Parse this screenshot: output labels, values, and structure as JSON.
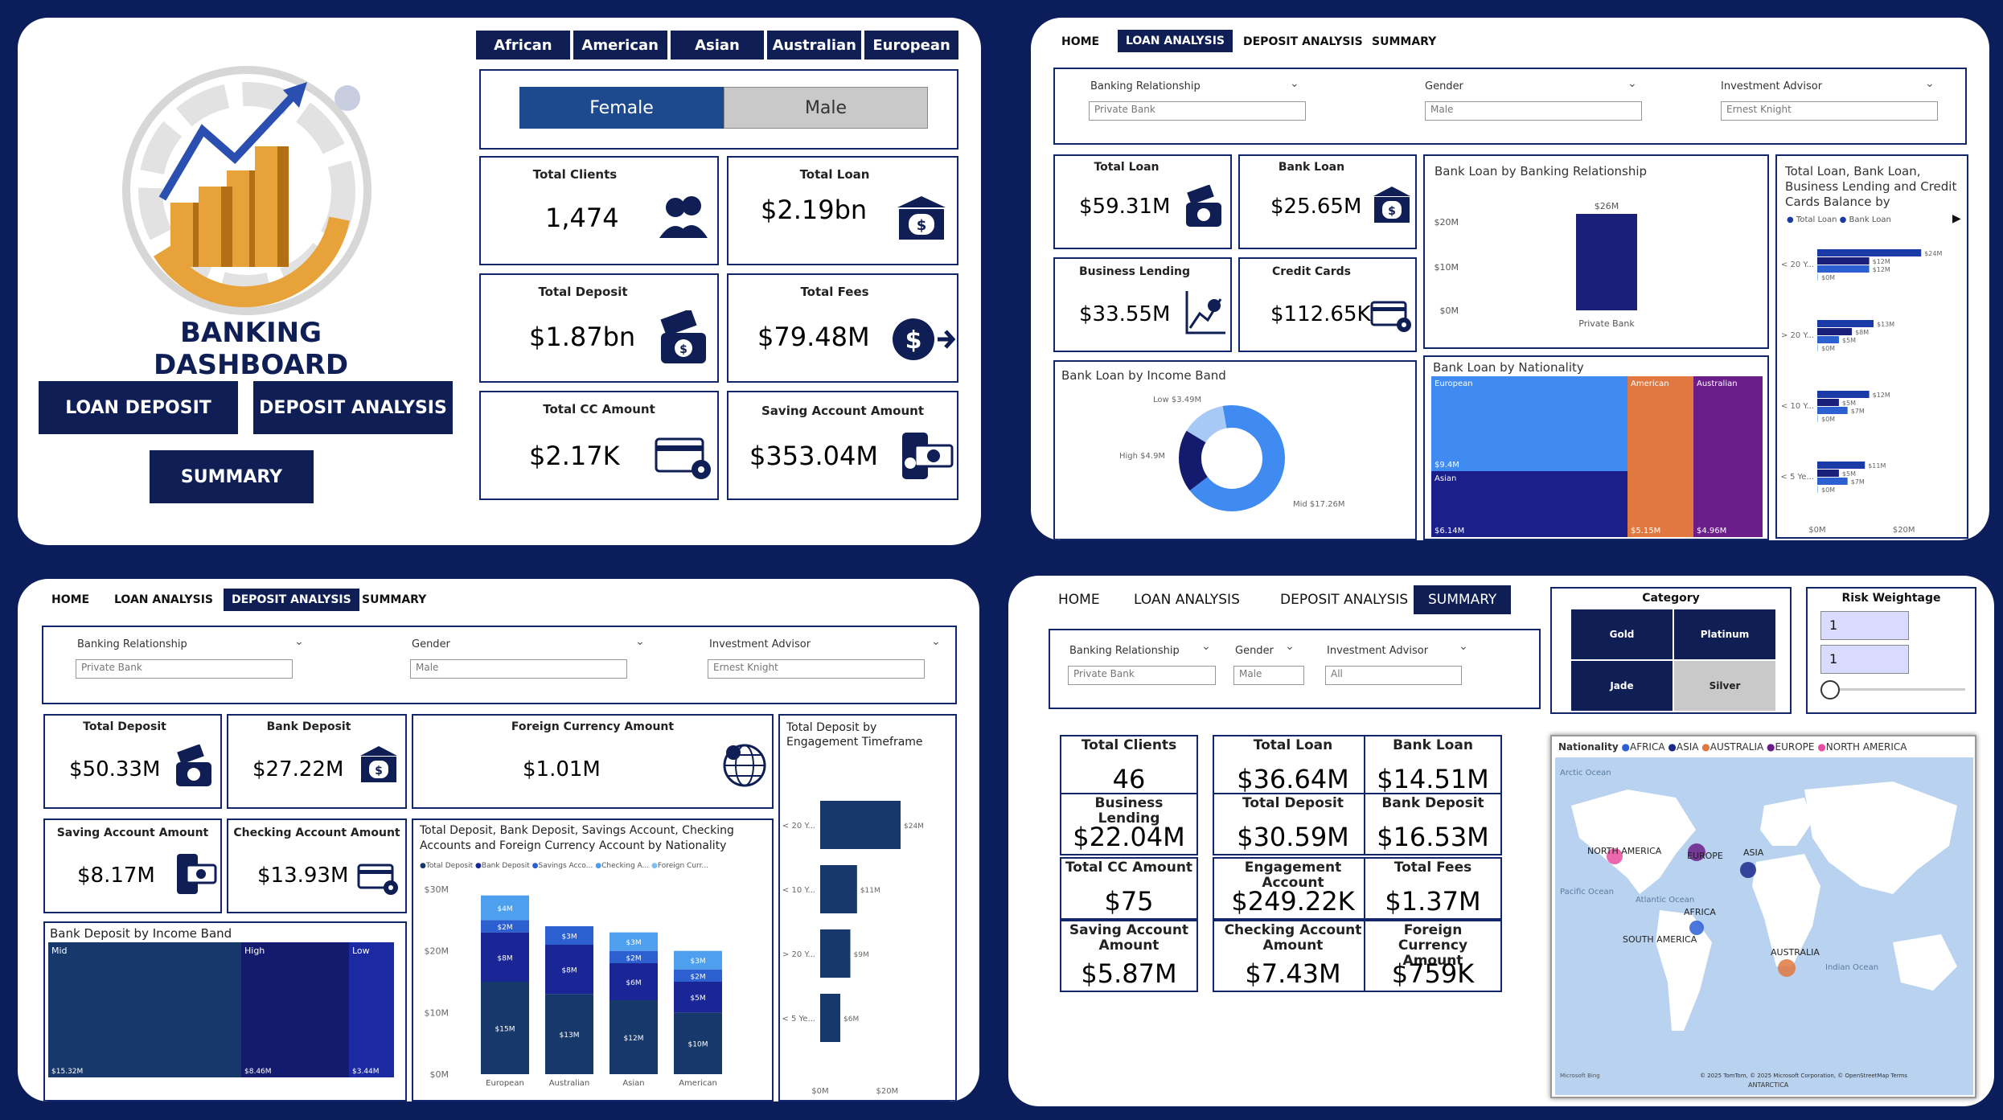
{
  "home": {
    "regions": [
      "African",
      "American",
      "Asian",
      "Australian",
      "European"
    ],
    "genders": [
      "Female",
      "Male"
    ],
    "title": "BANKING DASHBOARD",
    "buttons": {
      "loan_deposit": "LOAN DEPOSIT",
      "deposit_analysis": "DEPOSIT ANALYSIS",
      "summary": "SUMMARY"
    },
    "cards": {
      "total_clients": {
        "label": "Total Clients",
        "value": "1,474"
      },
      "total_loan": {
        "label": "Total Loan",
        "value": "$2.19bn"
      },
      "total_deposit": {
        "label": "Total Deposit",
        "value": "$1.87bn"
      },
      "total_fees": {
        "label": "Total Fees",
        "value": "$79.48M"
      },
      "total_cc": {
        "label": "Total CC Amount",
        "value": "$2.17K"
      },
      "saving": {
        "label": "Saving Account Amount",
        "value": "$353.04M"
      }
    }
  },
  "nav": {
    "home": "HOME",
    "loan": "LOAN ANALYSIS",
    "deposit": "DEPOSIT ANALYSIS",
    "summary": "SUMMARY"
  },
  "slicers": {
    "banking_relationship": "Banking Relationship",
    "private_bank": "Private Bank",
    "gender": "Gender",
    "male": "Male",
    "investment_advisor": "Investment Advisor",
    "ernest_knight": "Ernest Knight",
    "all": "All"
  },
  "loan": {
    "cards": {
      "total_loan": {
        "label": "Total Loan",
        "value": "$59.31M"
      },
      "bank_loan": {
        "label": "Bank Loan",
        "value": "$25.65M"
      },
      "business_lending": {
        "label": "Business Lending",
        "value": "$33.55M"
      },
      "credit_cards": {
        "label": "Credit Cards",
        "value": "$112.65K"
      }
    },
    "by_relationship": {
      "title": "Bank Loan by Banking Relationship",
      "bar_label": "$26M",
      "cat": "Private Bank",
      "ticks": [
        "$20M",
        "$10M",
        "$0M"
      ]
    },
    "by_income": {
      "title": "Bank Loan by Income Band",
      "low": "Low $3.49M",
      "high": "High $4.9M",
      "mid": "Mid $17.26M"
    },
    "by_nationality": {
      "title": "Bank Loan by Nationality",
      "european": "European",
      "european_val": "$9.4M",
      "asian": "Asian",
      "asian_val": "$6.14M",
      "american": "American",
      "american_val": "$5.15M",
      "australian": "Australian",
      "australian_val": "$4.96M"
    },
    "engagement": {
      "title": "Total Loan, Bank Loan, Business Lending and Credit Cards Balance by Engageme...",
      "legend1": "Total Loan",
      "legend2": "Bank Loan",
      "rows": [
        {
          "cat": "< 20 Y...",
          "v1": "$24M",
          "v2": "$12M",
          "v3": "$12M",
          "v4": "$0M"
        },
        {
          "cat": "> 20 Y...",
          "v1": "$13M",
          "v2": "$8M",
          "v3": "$5M",
          "v4": "$0M"
        },
        {
          "cat": "< 10 Y...",
          "v1": "$12M",
          "v2": "$5M",
          "v3": "$7M",
          "v4": "$0M"
        },
        {
          "cat": "< 5 Ye...",
          "v1": "$11M",
          "v2": "$5M",
          "v3": "$7M",
          "v4": "$0M"
        }
      ],
      "xticks": [
        "$0M",
        "$20M"
      ]
    }
  },
  "deposit": {
    "cards": {
      "total_deposit": {
        "label": "Total Deposit",
        "value": "$50.33M"
      },
      "bank_deposit": {
        "label": "Bank Deposit",
        "value": "$27.22M"
      },
      "foreign": {
        "label": "Foreign Currency Amount",
        "value": "$1.01M"
      },
      "saving": {
        "label": "Saving Account Amount",
        "value": "$8.17M"
      },
      "checking": {
        "label": "Checking Account Amount",
        "value": "$13.93M"
      }
    },
    "by_income": {
      "title": "Bank Deposit by Income Band",
      "mid": "Mid",
      "mid_val": "$15.32M",
      "high": "High",
      "high_val": "$8.46M",
      "low": "Low",
      "low_val": "$3.44M"
    },
    "by_nationality_title": "Total Deposit, Bank Deposit, Savings Account, Checking Accounts and Foreign Currency Account by Nationality",
    "legend": [
      "Total Deposit",
      "Bank Deposit",
      "Savings Acco...",
      "Checking A...",
      "Foreign Curr..."
    ],
    "by_engagement_title": "Total Deposit by Engagement Timeframe",
    "engagement_bars": [
      {
        "cat": "< 20 Y...",
        "label": "$24M"
      },
      {
        "cat": "< 10 Y...",
        "label": "$11M"
      },
      {
        "cat": "> 20 Y...",
        "label": "$9M"
      },
      {
        "cat": "< 5 Ye...",
        "label": "$6M"
      }
    ],
    "eng_xticks": [
      "$0M",
      "$20M"
    ]
  },
  "summary": {
    "category_title": "Category",
    "categories": [
      "Gold",
      "Platinum",
      "Jade",
      "Silver"
    ],
    "risk_title": "Risk Weightage",
    "risk_min": "1",
    "risk_max": "1",
    "cards": [
      {
        "label": "Total Clients",
        "value": "46"
      },
      {
        "label": "Total Loan",
        "value": "$36.64M"
      },
      {
        "label": "Bank Loan",
        "value": "$14.51M"
      },
      {
        "label": "Business Lending",
        "value": "$22.04M"
      },
      {
        "label": "Total Deposit",
        "value": "$30.59M"
      },
      {
        "label": "Bank Deposit",
        "value": "$16.53M"
      },
      {
        "label": "Total CC Amount",
        "value": "$75"
      },
      {
        "label": "Engagement Account",
        "value": "$249.22K"
      },
      {
        "label": "Total Fees",
        "value": "$1.37M"
      },
      {
        "label": "Saving Account Amount",
        "value": "$5.87M"
      },
      {
        "label": "Checking Account Amount",
        "value": "$7.43M"
      },
      {
        "label": "Foreign Currency Amount",
        "value": "$759K"
      }
    ],
    "map": {
      "legend_title": "Nationality",
      "legend": [
        "AFRICA",
        "ASIA",
        "AUSTRALIA",
        "EUROPE",
        "NORTH AMERICA"
      ],
      "labels": [
        "NORTH AMERICA",
        "EUROPE",
        "ASIA",
        "AFRICA",
        "SOUTH AMERICA",
        "AUSTRALIA",
        "Atlantic Ocean",
        "Indian Ocean",
        "Pacific Ocean",
        "Arctic Ocean"
      ],
      "credit": "© 2025 TomTom, © 2025 Microsoft Corporation, © OpenStreetMap  Terms",
      "bing": "Microsoft Bing",
      "antarctica": "ANTARCTICA"
    }
  },
  "chart_data": [
    {
      "type": "bar",
      "title": "Bank Loan by Banking Relationship",
      "categories": [
        "Private Bank"
      ],
      "values": [
        26
      ],
      "ylim": [
        0,
        26
      ]
    },
    {
      "type": "pie",
      "title": "Bank Loan by Income Band",
      "categories": [
        "Mid",
        "High",
        "Low"
      ],
      "values": [
        17.26,
        4.9,
        3.49
      ]
    },
    {
      "type": "heatmap",
      "title": "Bank Loan by Nationality",
      "categories": [
        "European",
        "Asian",
        "American",
        "Australian"
      ],
      "values": [
        9.4,
        6.14,
        5.15,
        4.96
      ]
    },
    {
      "type": "bar",
      "title": "Total Loan, Bank Loan, Business Lending and Credit Cards Balance by Engageme...",
      "categories": [
        "< 20 Y...",
        "> 20 Y...",
        "< 10 Y...",
        "< 5 Ye..."
      ],
      "series": [
        {
          "name": "Total Loan",
          "values": [
            24,
            13,
            12,
            11
          ]
        },
        {
          "name": "Bank Loan",
          "values": [
            12,
            8,
            5,
            5
          ]
        },
        {
          "values": [
            12,
            5,
            7,
            7
          ]
        },
        {
          "values": [
            0,
            0,
            0,
            0
          ]
        }
      ]
    },
    {
      "type": "heatmap",
      "title": "Bank Deposit by Income Band",
      "categories": [
        "Mid",
        "High",
        "Low"
      ],
      "values": [
        15.32,
        8.46,
        3.44
      ]
    },
    {
      "type": "bar",
      "title": "Total Deposit, Bank Deposit, Savings Account, Checking Accounts and Foreign Currency Account by Nationality",
      "categories": [
        "European",
        "Australian",
        "Asian",
        "American"
      ],
      "ylim": [
        0,
        30
      ],
      "series": [
        {
          "name": "Total Deposit",
          "values": [
            15,
            13,
            12,
            10
          ]
        },
        {
          "name": "Bank Deposit",
          "values": [
            8,
            8,
            6,
            5
          ]
        },
        {
          "name": "Savings Acco...",
          "values": [
            2,
            3,
            2,
            2
          ]
        },
        {
          "name": "Checking A...",
          "values": [
            4,
            0,
            3,
            3
          ]
        },
        {
          "name": "Foreign Curr...",
          "values": [
            0,
            0,
            0,
            0
          ]
        }
      ]
    },
    {
      "type": "bar",
      "title": "Total Deposit by Engagement Timeframe",
      "categories": [
        "< 20 Y...",
        "< 10 Y...",
        "> 20 Y...",
        "< 5 Ye..."
      ],
      "values": [
        24,
        11,
        9,
        6
      ]
    }
  ]
}
